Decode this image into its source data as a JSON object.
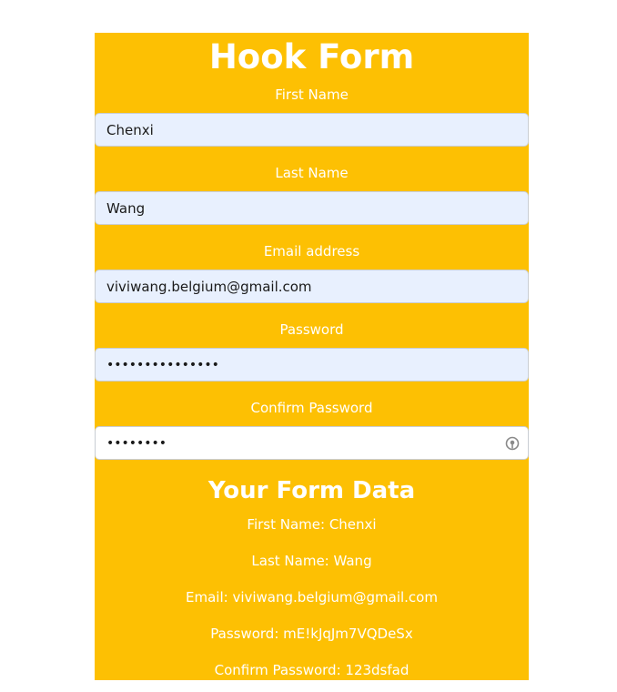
{
  "form": {
    "title": "Hook Form",
    "fields": [
      {
        "label": "First Name",
        "value": "Chenxi",
        "type": "text"
      },
      {
        "label": "Last Name",
        "value": "Wang",
        "type": "text"
      },
      {
        "label": "Email address",
        "value": "viviwang.belgium@gmail.com",
        "type": "email"
      },
      {
        "label": "Password",
        "value": "mE!kJqJm7VQDeSx",
        "type": "password"
      },
      {
        "label": "Confirm Password",
        "value": "123dsfad",
        "type": "password"
      }
    ]
  },
  "form_data": {
    "title": "Your Form Data",
    "lines": [
      "First Name: Chenxi",
      "Last Name: Wang",
      "Email: viviwang.belgium@gmail.com",
      "Password: mE!kJqJm7VQDeSx",
      "Confirm Password: 123dsfad"
    ]
  },
  "colors": {
    "panel_background": "#fdc003",
    "autofill_background": "#e8f0fe",
    "text_light": "#ffffff"
  },
  "icons": {
    "confirm_password_suffix": "password-manager-key-icon"
  }
}
